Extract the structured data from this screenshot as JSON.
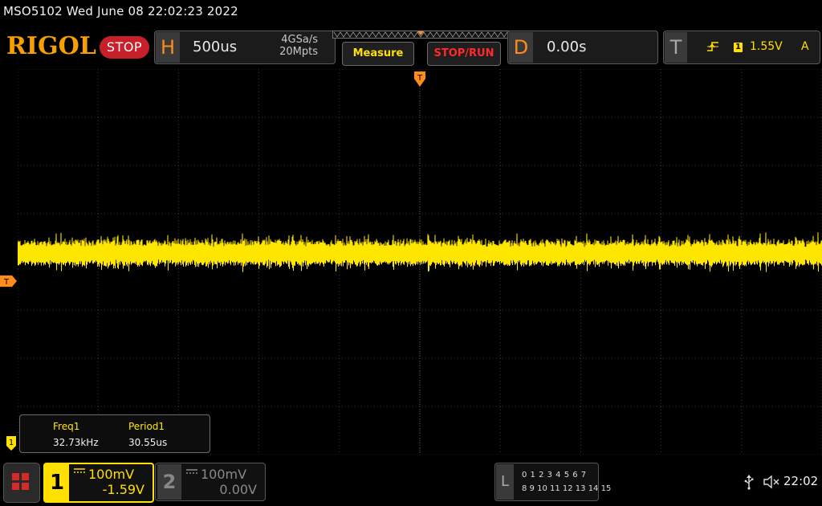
{
  "title_line": "MSO5102  Wed June 08 22:02:23 2022",
  "brand": "RIGOL",
  "run_state": "STOP",
  "horizontal": {
    "letter": "H",
    "timebase": "500us",
    "sample_rate": "4GSa/s",
    "memory_depth": "20Mpts"
  },
  "buttons": {
    "measure": "Measure",
    "stop_run": "STOP/RUN"
  },
  "delay": {
    "letter": "D",
    "value": "0.00s"
  },
  "trigger": {
    "letter": "T",
    "source": "1",
    "level": "1.55V",
    "mode": "A",
    "marker": "T",
    "slope_icon": "rising-edge-icon"
  },
  "measurements": [
    {
      "label": "Freq1",
      "value": "32.73kHz"
    },
    {
      "label": "Period1",
      "value": "30.55us"
    }
  ],
  "channels": [
    {
      "num": "1",
      "scale": "100mV",
      "offset": "-1.59V",
      "color": "#ffe000",
      "active": true
    },
    {
      "num": "2",
      "scale": "100mV",
      "offset": "0.00V",
      "color": "#8a8a8a",
      "active": false
    }
  ],
  "ch1_marker": "1",
  "logic": {
    "letter": "L",
    "row1": "0 1 2 3  4 5 6 7",
    "row2": "8 9 10 11 12 13 14 15"
  },
  "status": {
    "clock": "22:02",
    "usb_icon": "usb-icon",
    "speaker_icon": "speaker-muted-icon"
  },
  "colors": {
    "accent": "#f5a000",
    "ch1": "#ffe000",
    "stop": "#c8202a",
    "trigger_marker": "#ff8c1a"
  }
}
